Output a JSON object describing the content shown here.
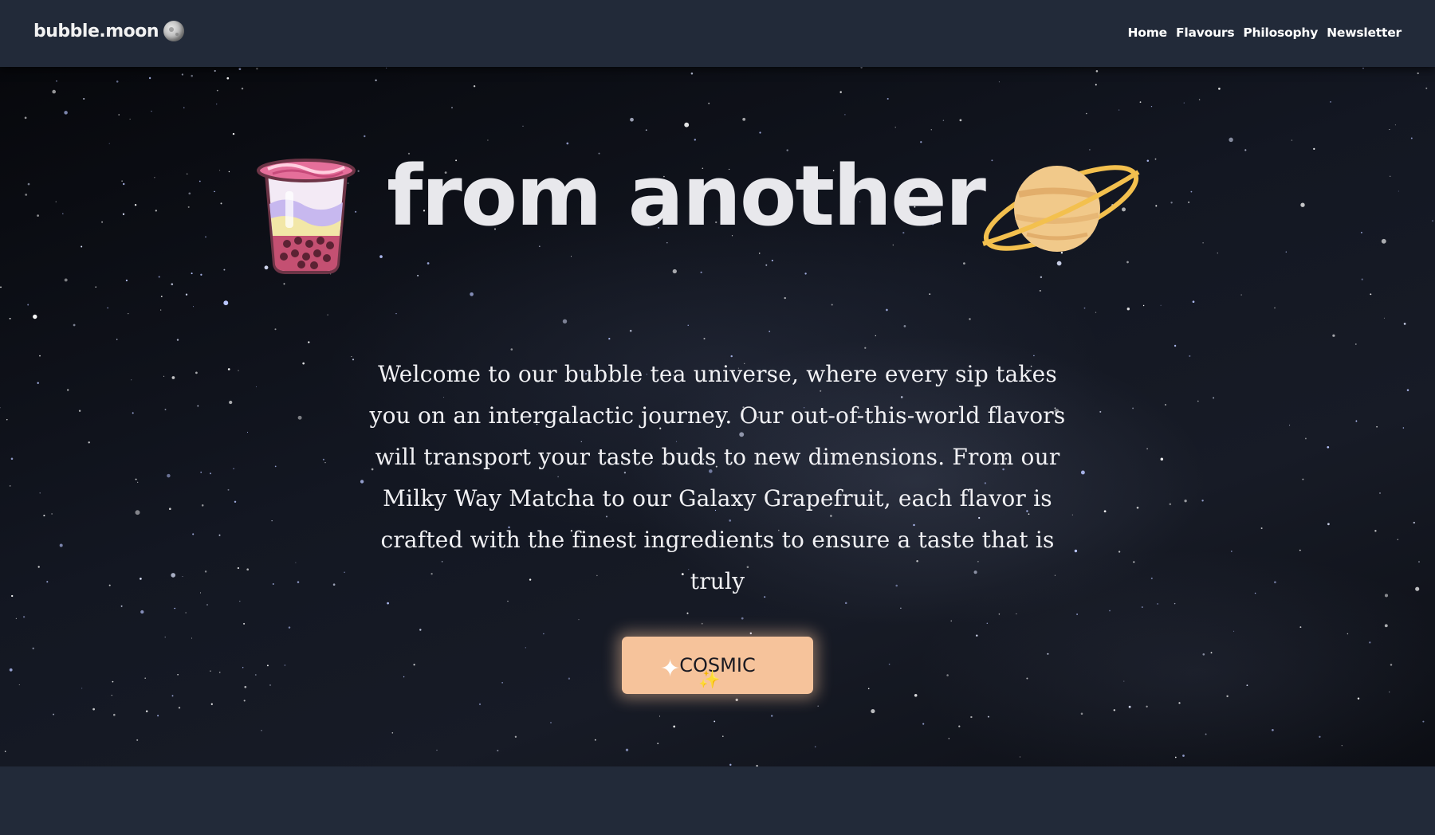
{
  "header": {
    "brand": "bubble.moon",
    "brand_icon": "moon-icon",
    "nav": [
      {
        "label": "Home"
      },
      {
        "label": "Flavours"
      },
      {
        "label": "Philosophy"
      },
      {
        "label": "Newsletter"
      }
    ]
  },
  "hero": {
    "title": "from another",
    "left_icon": "bubble-tea-cup-icon",
    "right_icon": "ringed-planet-icon",
    "body": "Welcome to our bubble tea universe, where every sip takes you on an intergalactic journey. Our out-of-this-world flavors will transport your taste buds to new dimensions. From our Milky Way Matcha to our Galaxy Grapefruit, each flavor is crafted with the finest ingredients to ensure a taste that is truly",
    "cta": {
      "label": "COSMIC",
      "icon": "sparkles-icon"
    }
  },
  "colors": {
    "page_bg": "#222a39",
    "sky_dark": "#0b0d13",
    "text": "#f1f1f4",
    "cta_bg": "#f6c39b",
    "planet": "#f1c98a",
    "planet_ring": "#f3c04e",
    "cup_topping": "#e56f9a"
  }
}
